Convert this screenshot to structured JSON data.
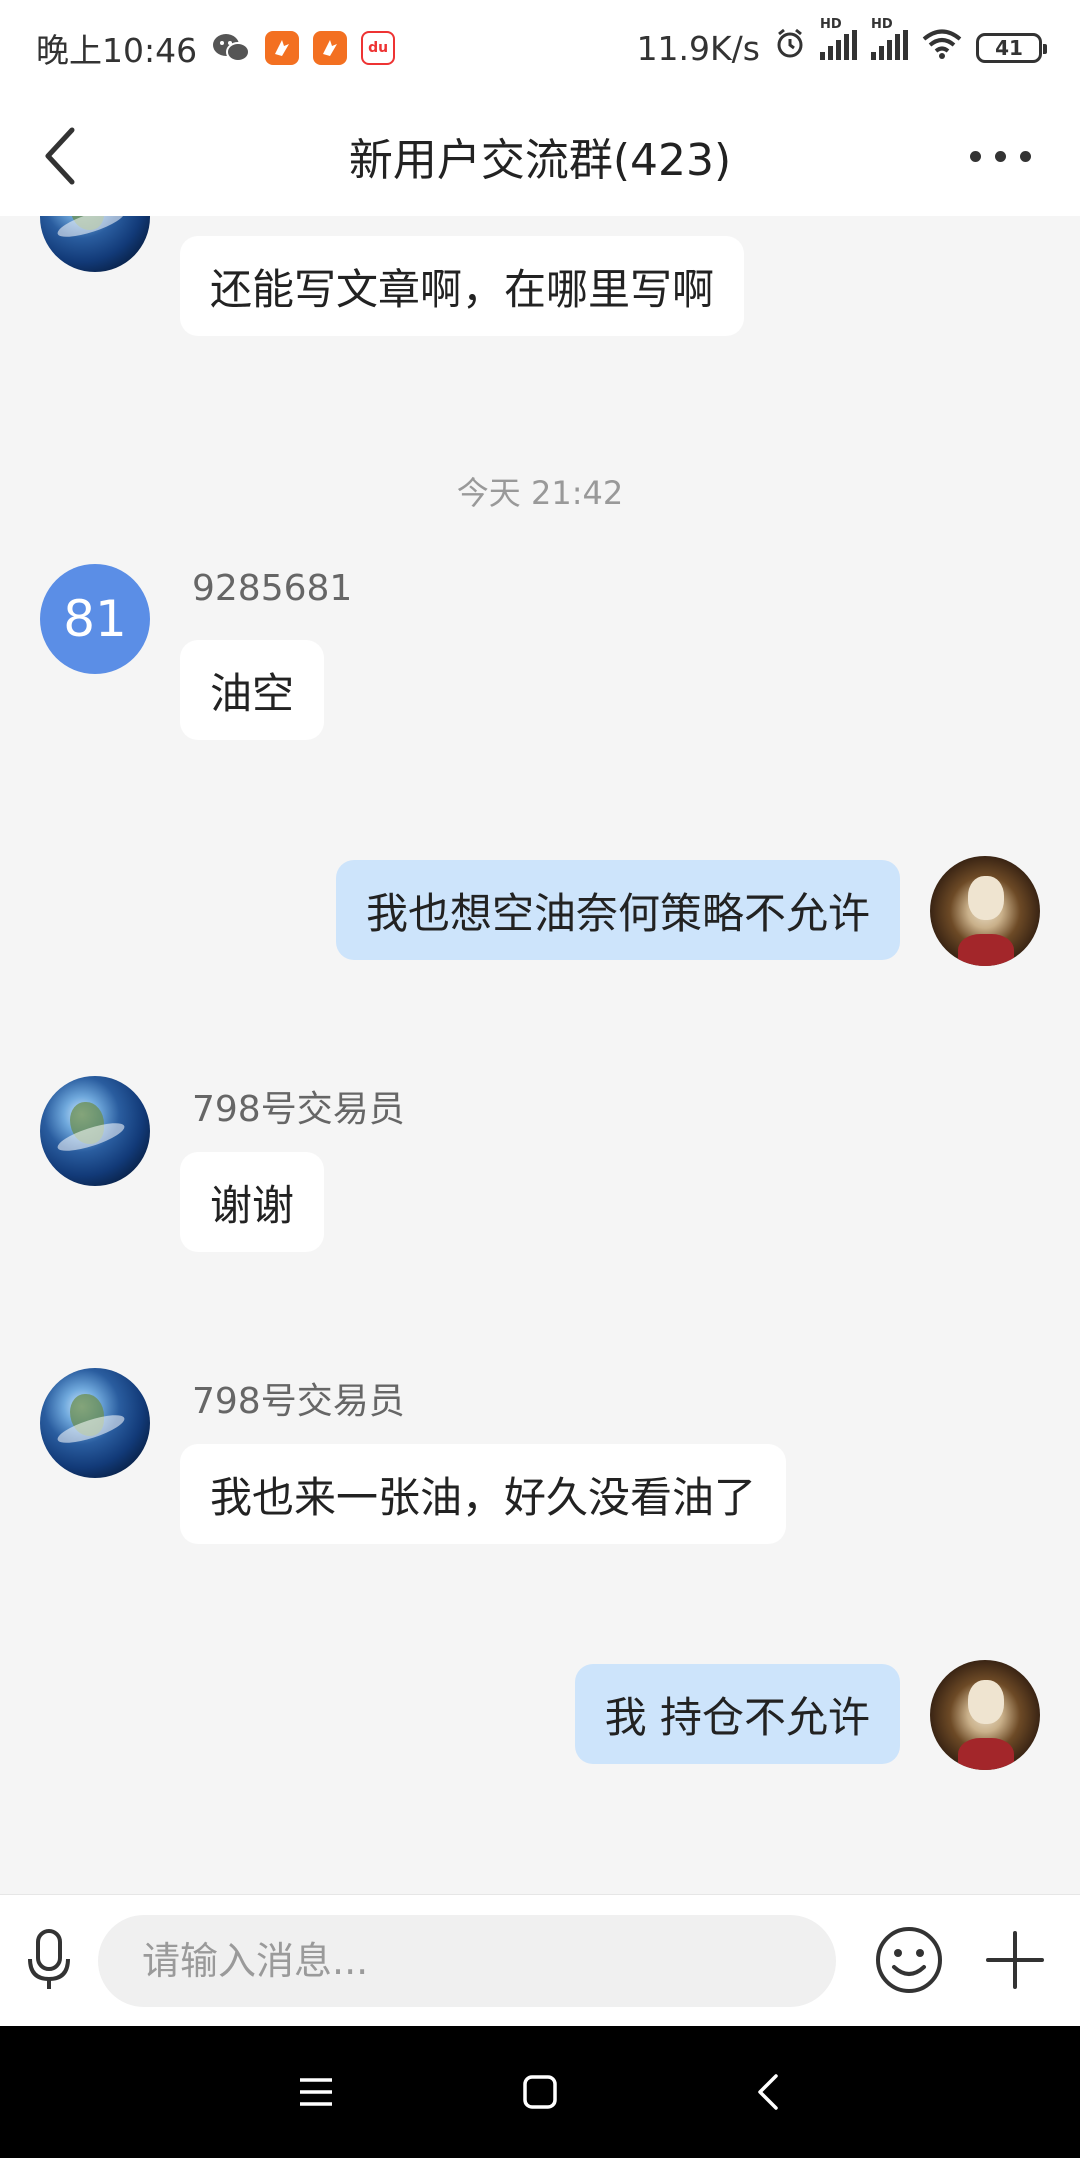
{
  "status_bar": {
    "time": "晚上10:46",
    "network_speed": "11.9K/s",
    "battery": "41",
    "hd1": "HD",
    "hd2": "HD",
    "map_label": "du"
  },
  "header": {
    "title": "新用户交流群(423)"
  },
  "chat": {
    "messages": [
      {
        "direction": "incoming",
        "avatar": "earth",
        "sender": "",
        "text": "还能写文章啊，在哪里写啊"
      },
      {
        "type": "time",
        "text": "今天 21:42"
      },
      {
        "direction": "incoming",
        "avatar": "number",
        "avatar_text": "81",
        "sender": "9285681",
        "text": "油空"
      },
      {
        "direction": "outgoing",
        "avatar": "joker",
        "text": "我也想空油奈何策略不允许"
      },
      {
        "direction": "incoming",
        "avatar": "earth",
        "sender": "798号交易员",
        "text": "谢谢"
      },
      {
        "direction": "incoming",
        "avatar": "earth",
        "sender": "798号交易员",
        "text": "我也来一张油，好久没看油了"
      },
      {
        "direction": "outgoing",
        "avatar": "joker",
        "text": "我 持仓不允许"
      }
    ]
  },
  "input_bar": {
    "placeholder": "请输入消息..."
  },
  "colors": {
    "outgoing_bubble": "#cde4fb",
    "incoming_bubble": "#ffffff",
    "number_avatar": "#5b8ee6",
    "background": "#f5f5f5"
  }
}
